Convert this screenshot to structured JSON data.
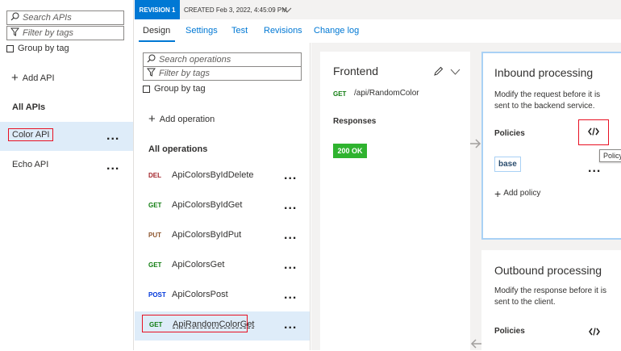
{
  "left_panel": {
    "search_placeholder": "Search APIs",
    "filter_placeholder": "Filter by tags",
    "group_by_tag": "Group by tag",
    "add_api": "Add API",
    "all_apis": "All APIs",
    "apis": [
      "Color API",
      "Echo API"
    ],
    "more": "..."
  },
  "header": {
    "revision_badge": "REVISION 1",
    "created": "CREATED Feb 3, 2022, 4:45:09 PM"
  },
  "tabs": [
    "Design",
    "Settings",
    "Test",
    "Revisions",
    "Change log"
  ],
  "operations_panel": {
    "search_placeholder": "Search operations",
    "filter_placeholder": "Filter by tags",
    "group_by_tag": "Group by tag",
    "add_operation": "Add operation",
    "all_operations": "All operations",
    "operations": [
      {
        "method": "DEL",
        "name": "ApiColorsByIdDelete",
        "color": "#a4262c"
      },
      {
        "method": "GET",
        "name": "ApiColorsByIdGet",
        "color": "#107c10"
      },
      {
        "method": "PUT",
        "name": "ApiColorsByIdPut",
        "color": "#8e562e"
      },
      {
        "method": "GET",
        "name": "ApiColorsGet",
        "color": "#107c10"
      },
      {
        "method": "POST",
        "name": "ApiColorsPost",
        "color": "#0037da"
      },
      {
        "method": "GET",
        "name": "ApiRandomColorGet",
        "color": "#107c10"
      }
    ]
  },
  "frontend": {
    "title": "Frontend",
    "method": "GET",
    "path": "/api/RandomColor",
    "responses_label": "Responses",
    "response_badge": "200 OK"
  },
  "inbound": {
    "title": "Inbound processing",
    "description": "Modify the request before it is sent to the backend service.",
    "policies_label": "Policies",
    "base_tag": "base",
    "add_policy": "Add policy",
    "tooltip": "Policy"
  },
  "outbound": {
    "title": "Outbound processing",
    "description": "Modify the response before it is sent to the client.",
    "policies_label": "Policies"
  },
  "colors": {
    "accent": "#0078d4",
    "selected_bg": "#deecf9",
    "badge_green": "#2fb32f",
    "highlight_red": "#e81123"
  }
}
